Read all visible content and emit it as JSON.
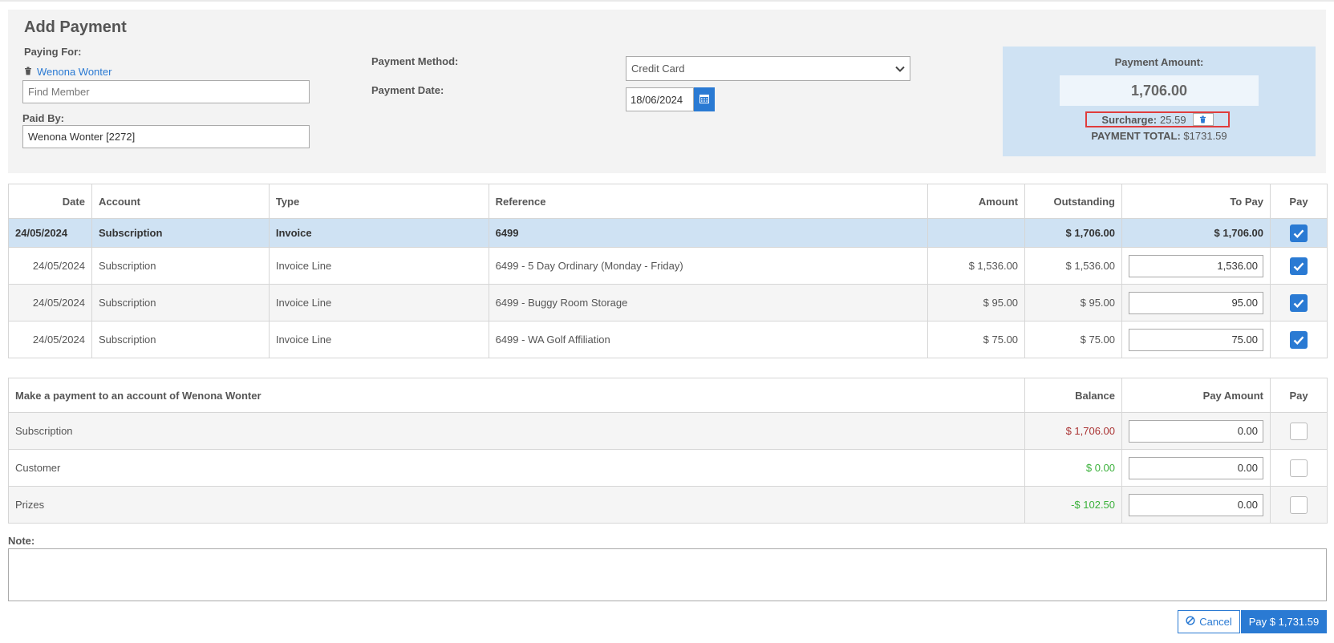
{
  "header": {
    "title": "Add Payment",
    "paying_for_label": "Paying For:",
    "paying_for_member": "Wenona Wonter",
    "find_member_placeholder": "Find Member",
    "paid_by_label": "Paid By:",
    "paid_by_value": "Wenona Wonter [2272]",
    "payment_method_label": "Payment Method:",
    "payment_method_value": "Credit Card",
    "payment_date_label": "Payment Date:",
    "payment_date_value": "18/06/2024"
  },
  "amount_box": {
    "label": "Payment Amount:",
    "value": "1,706.00",
    "surcharge_label": "Surcharge:",
    "surcharge_value": "25.59",
    "total_label": "PAYMENT TOTAL:",
    "total_value": "$1731.59"
  },
  "invoice_table": {
    "headers": [
      "Date",
      "Account",
      "Type",
      "Reference",
      "Amount",
      "Outstanding",
      "To Pay",
      "Pay"
    ],
    "invoice_row": {
      "date": "24/05/2024",
      "account": "Subscription",
      "type": "Invoice",
      "reference": "6499",
      "amount": "",
      "outstanding": "$ 1,706.00",
      "to_pay": "$ 1,706.00",
      "checked": true
    },
    "lines": [
      {
        "date": "24/05/2024",
        "account": "Subscription",
        "type": "Invoice Line",
        "reference": "6499 - 5 Day Ordinary (Monday - Friday)",
        "amount": "$ 1,536.00",
        "outstanding": "$ 1,536.00",
        "to_pay": "1,536.00",
        "checked": true
      },
      {
        "date": "24/05/2024",
        "account": "Subscription",
        "type": "Invoice Line",
        "reference": "6499 - Buggy Room Storage",
        "amount": "$ 95.00",
        "outstanding": "$ 95.00",
        "to_pay": "95.00",
        "checked": true
      },
      {
        "date": "24/05/2024",
        "account": "Subscription",
        "type": "Invoice Line",
        "reference": "6499 - WA Golf Affiliation",
        "amount": "$ 75.00",
        "outstanding": "$ 75.00",
        "to_pay": "75.00",
        "checked": true
      }
    ]
  },
  "account_table": {
    "headers": [
      "Make a payment to an account of Wenona Wonter",
      "Balance",
      "Pay Amount",
      "Pay"
    ],
    "rows": [
      {
        "account": "Subscription",
        "balance": "$ 1,706.00",
        "balance_color": "red",
        "pay_amount": "0.00",
        "checked": false
      },
      {
        "account": "Customer",
        "balance": "$ 0.00",
        "balance_color": "green",
        "pay_amount": "0.00",
        "checked": false
      },
      {
        "account": "Prizes",
        "balance": "-$ 102.50",
        "balance_color": "green",
        "pay_amount": "0.00",
        "checked": false
      }
    ]
  },
  "note_label": "Note:",
  "buttons": {
    "cancel": "Cancel",
    "pay": "Pay $ 1,731.59"
  },
  "colors": {
    "accent": "#2a7ad3",
    "highlight_row": "#cfe2f3",
    "negative": "#aa3333",
    "positive": "#3bb13b",
    "surcharge_outline": "#e03c3c"
  }
}
